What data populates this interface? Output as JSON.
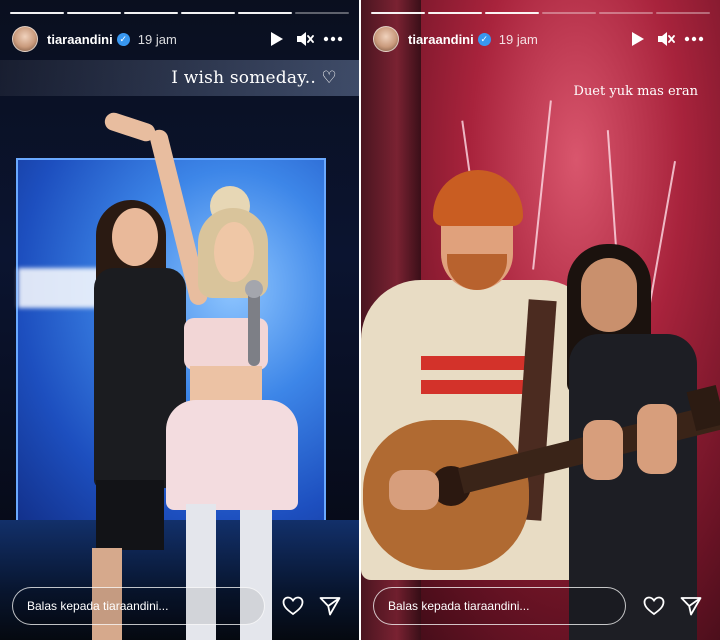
{
  "stories": [
    {
      "username": "tiaraandini",
      "verified_icon": "verified-badge-icon",
      "time": "19 jam",
      "caption": "I wish someday.. ♡",
      "reply_placeholder": "Balas kepada tiaraandini...",
      "progress": [
        true,
        true,
        true,
        true,
        true,
        false
      ]
    },
    {
      "username": "tiaraandini",
      "verified_icon": "verified-badge-icon",
      "time": "19 jam",
      "caption": "Duet yuk mas eran",
      "reply_placeholder": "Balas kepada tiaraandini...",
      "progress": [
        true,
        true,
        true,
        false,
        false,
        false
      ]
    }
  ],
  "icons": {
    "play": "play-icon",
    "mute": "mute-icon",
    "more": "more-icon",
    "like": "heart-icon",
    "share": "send-icon"
  },
  "colors": {
    "verified": "#3897f0",
    "left_backdrop": "#3d86e8",
    "right_backdrop": "#a8233c"
  }
}
